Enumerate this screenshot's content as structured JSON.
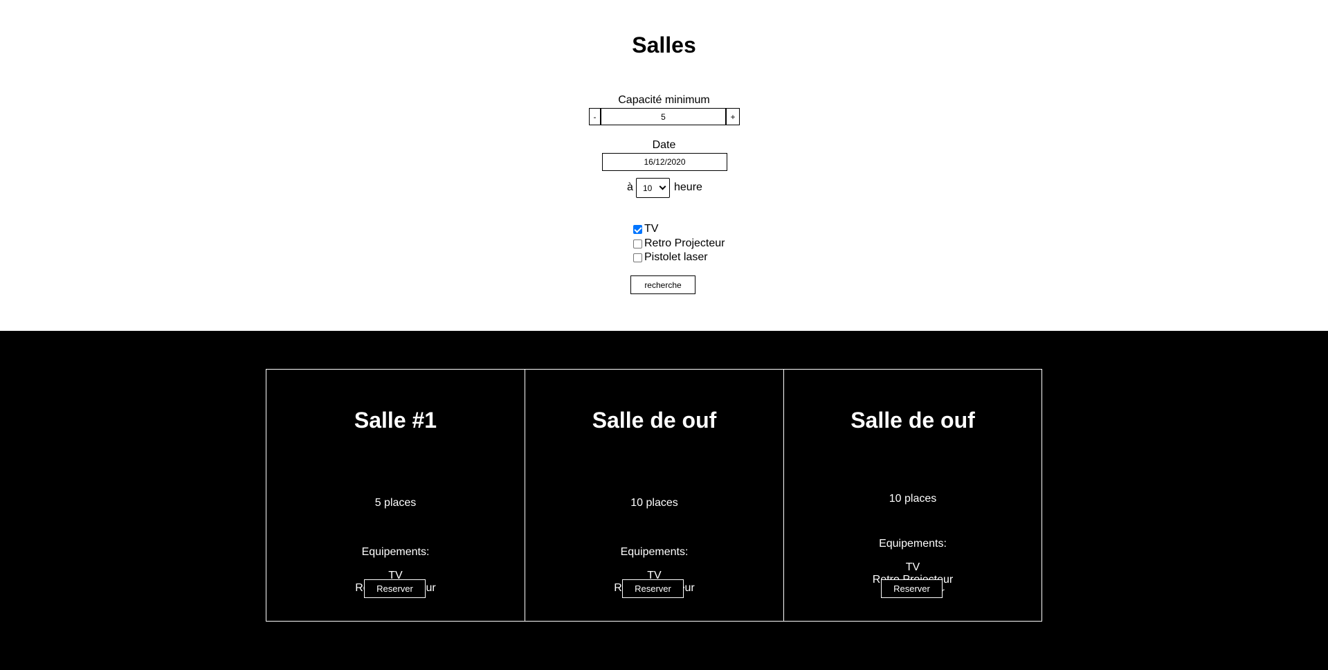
{
  "page": {
    "title": "Salles"
  },
  "filters": {
    "capacity": {
      "label": "Capacité minimum",
      "value": "5",
      "minus_label": "-",
      "plus_label": "+"
    },
    "date": {
      "label": "Date",
      "value": "16/12/2020"
    },
    "hour": {
      "prefix": "à",
      "value": "10",
      "suffix": "heure"
    },
    "equipment": [
      {
        "label": "TV",
        "checked": true
      },
      {
        "label": "Retro Projecteur",
        "checked": false
      },
      {
        "label": "Pistolet laser",
        "checked": false
      }
    ],
    "search_label": "recherche"
  },
  "rooms": [
    {
      "name": "Salle #1",
      "capacity": "5 places",
      "equipment_label": "Equipements:",
      "equipment": [
        "TV",
        "Retro Projecteur"
      ],
      "button": "Reserver"
    },
    {
      "name": "Salle de ouf",
      "capacity": "10 places",
      "equipment_label": "Equipements:",
      "equipment": [
        "TV",
        "Retro Projecteur"
      ],
      "button": "Reserver"
    },
    {
      "name": "Salle de ouf",
      "capacity": "10 places",
      "equipment_label": "Equipements:",
      "equipment": [
        "TV",
        "Retro Projecteur",
        "Pistolet laser"
      ],
      "button": "Reserver"
    }
  ],
  "colors": {
    "accent": "#0075ff",
    "results_bg": "#000000",
    "page_bg": "#ffffff"
  }
}
